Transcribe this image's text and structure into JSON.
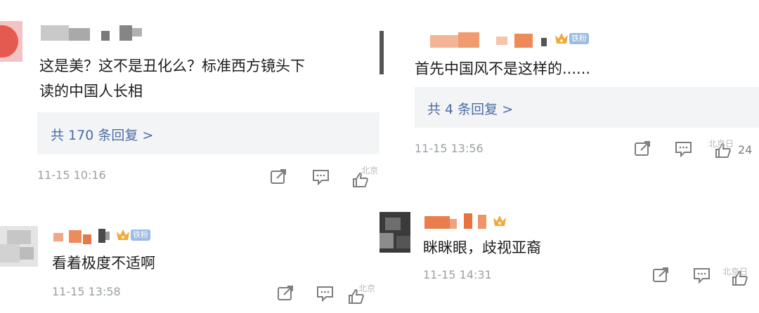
{
  "left": {
    "comment1": {
      "text_line1": "这是美？这不是丑化么？标准西方镜头下",
      "text_line2": "读的中国人长相",
      "replies": "共 170 条回复 >",
      "time": "11-15 10:16",
      "watermark": "北京"
    },
    "comment2": {
      "text": "看着极度不适啊",
      "fan_badge": "铁粉",
      "time": "11-15 13:58",
      "watermark": "北京"
    }
  },
  "right": {
    "comment1": {
      "text": "首先中国风不是这样的......",
      "fan_badge": "铁粉",
      "replies": "共 4 条回复 >",
      "time": "11-15 13:56",
      "watermark": "北京日",
      "like_count": "24"
    },
    "comment2": {
      "text": "眯眯眼，歧视亚裔",
      "time": "11-15 14:31",
      "watermark": "北京日"
    }
  },
  "icons": {
    "share": "share-icon",
    "comment": "comment-icon",
    "like": "like-icon",
    "crown": "crown-icon"
  },
  "colors": {
    "reply_link": "#4a6da4",
    "reply_bg": "#f3f4f6",
    "timestamp": "#9aa0a6",
    "fan_badge": "#9bbbe6",
    "crown": "#f2a93b"
  }
}
